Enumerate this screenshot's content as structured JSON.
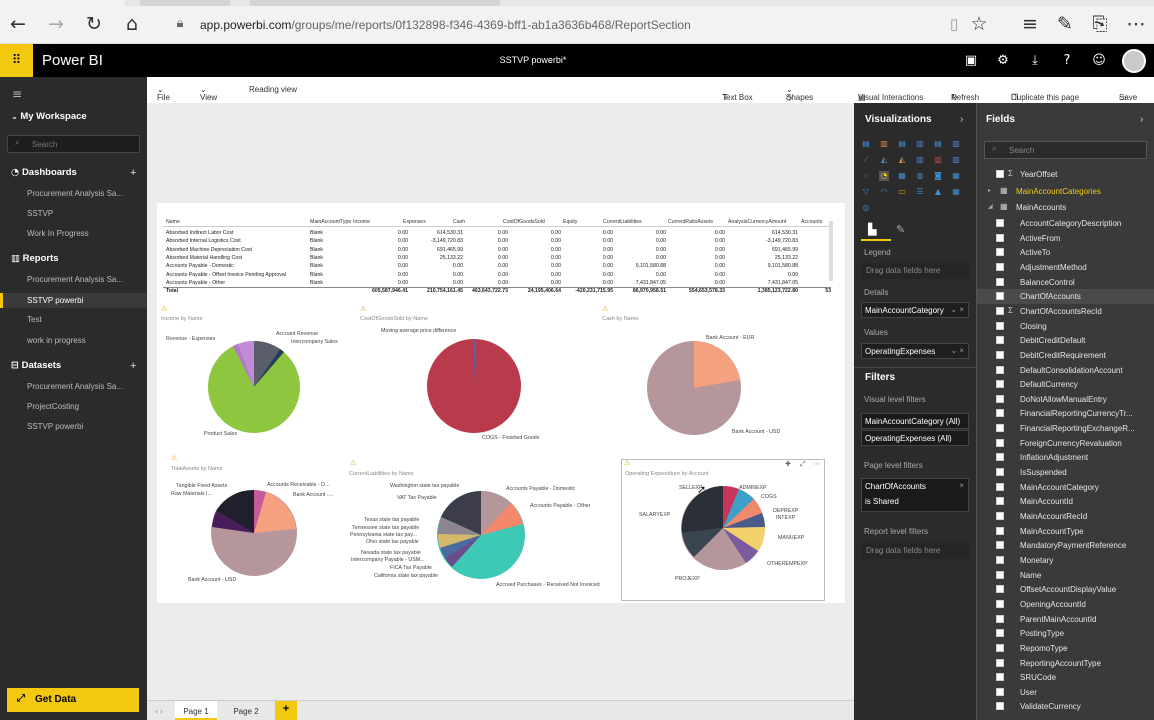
{
  "browser": {
    "url_domain": "app.powerbi.com",
    "url_path": "/groups/me/reports/0f132898-f346-4369-bff1-ab1a3636b468/ReportSection",
    "icons": [
      "back-icon",
      "forward-icon",
      "refresh-icon",
      "home-icon",
      "lock-icon",
      "reading-view-icon",
      "favorite-star-icon",
      "hub-icon",
      "notes-icon",
      "share-icon",
      "more-icon"
    ]
  },
  "header": {
    "brand": "Power BI",
    "title": "SSTVP powerbi*"
  },
  "nav": {
    "workspace": "My Workspace",
    "search_placeholder": "Search",
    "dashboards_label": "Dashboards",
    "dashboards": [
      "Procurement Analysis Sa...",
      "SSTVP",
      "Work In Progress"
    ],
    "reports_label": "Reports",
    "reports": [
      "Procurement Analysis Sa...",
      "SSTVP powerbi",
      "Test",
      "work in progress"
    ],
    "datasets_label": "Datasets",
    "datasets": [
      "Procurement Analysis Sa...",
      "ProjectCosting",
      "SSTVP powerbi"
    ],
    "get_data": "Get Data"
  },
  "toolbar": {
    "file": "File",
    "view": "View",
    "reading_view": "Reading view",
    "text_box": "Text Box",
    "shapes": "Shapes",
    "visual_interactions": "Visual Interactions",
    "refresh": "Refresh",
    "duplicate": "Duplicate this page",
    "save": "Save"
  },
  "table": {
    "headers": [
      "Name",
      "MainAccountType",
      "Income",
      "Expenses",
      "Cash",
      "CostOfGoodsSold",
      "Equity",
      "CurrentLiabilities",
      "CurrentRatioAssets",
      "AnalysisCurrencyAmount",
      "Accounts"
    ],
    "rows": [
      [
        "Absorbed Indirect Labor Cost",
        "Blank",
        "0.00",
        "614,530.31",
        "0.00",
        "0.00",
        "0.00",
        "0.00",
        "0.00",
        "614,530.31"
      ],
      [
        "Absorbed Internal Logistics Cost",
        "Blank",
        "0.00",
        "-3,149,720.83",
        "0.00",
        "0.00",
        "0.00",
        "0.00",
        "0.00",
        "-3,149,720.83"
      ],
      [
        "Absorbed Machine Depreciation Cost",
        "Blank",
        "0.00",
        "691,465.99",
        "0.00",
        "0.00",
        "0.00",
        "0.00",
        "0.00",
        "691,465.99"
      ],
      [
        "Absorbed Material Handling Cost",
        "Blank",
        "0.00",
        "25,133.22",
        "0.00",
        "0.00",
        "0.00",
        "0.00",
        "0.00",
        "25,133.22"
      ],
      [
        "Accounts Payable - Domestic",
        "Blank",
        "0.00",
        "0.00",
        "0.00",
        "0.00",
        "0.00",
        "9,101,580.88",
        "0.00",
        "9,101,580.88"
      ],
      [
        "Accounts Payable - Offset Invoice Pending Approval",
        "Blank",
        "0.00",
        "0.00",
        "0.00",
        "0.00",
        "0.00",
        "0.00",
        "0.00",
        "0.00"
      ],
      [
        "Accounts Payable - Other",
        "Blank",
        "0.00",
        "0.00",
        "0.00",
        "0.00",
        "0.00",
        "7,431,847.05",
        "0.00",
        "7,431,847.05"
      ]
    ],
    "total": [
      "Total",
      "",
      "605,587,946.41",
      "210,754,161.45",
      "463,643,722.73",
      "24,195,406.64",
      "-420,231,715.95",
      "86,970,958.51",
      "554,653,578.33",
      "1,385,123,722.80",
      "53"
    ]
  },
  "charts": [
    {
      "title": "Income by Name",
      "labels": [
        "Revenue - Expenses",
        "Accrued Revenue",
        "Intercompany Sales",
        "Product Sales"
      ]
    },
    {
      "title": "CostOfGoodsSold by Name",
      "labels": [
        "Moving average price difference",
        "COGS - Finished Goods"
      ]
    },
    {
      "title": "Cash by Name",
      "labels": [
        "Bank Account - EUR",
        "Bank Account - USD"
      ]
    },
    {
      "title": "TotalAssets by Name",
      "labels": [
        "Tangible Fixed Assets",
        "Raw Materials I...",
        "Accounts Receivable - D...",
        "Bank Account -...",
        "Bank Account - USD"
      ]
    },
    {
      "title": "CurrentLiabilities by Name",
      "labels": [
        "Washington state tax payable",
        "Accounts Payable - Domestic",
        "VAT Tax Payable",
        "Accounts Payable - Other",
        "Texas state tax payable",
        "Tennessee state tax payable",
        "Pennsylvania state tax pay...",
        "Ohio state tax payable",
        "Nevada state tax payable",
        "Intercompany Payable - USM...",
        "FICA Tax Payable",
        "California state tax payable",
        "Accrued Purchases - Received Not Invoiced"
      ]
    },
    {
      "title": "Operating Expenditure by Account",
      "labels": [
        "SELLEXP",
        "ADMINEXP",
        "COGS",
        "SALARYEXP",
        "DEPREXP",
        "INTEXP",
        "MANUEXP",
        "OTHEREMPEXP",
        "PROJEXP"
      ]
    }
  ],
  "visualizations": {
    "title": "Visualizations",
    "legend_label": "Legend",
    "legend_drop": "Drag data fields here",
    "details_label": "Details",
    "details_value": "MainAccountCategory",
    "values_label": "Values",
    "values_value": "OperatingExpenses"
  },
  "filters": {
    "title": "Filters",
    "visual_level": "Visual level filters",
    "visual_items": [
      "MainAccountCategory (All)",
      "OperatingExpenses (All)"
    ],
    "page_level": "Page level filters",
    "page_item_name": "ChartOfAccounts",
    "page_item_state": "is Shared",
    "report_level": "Report level filters",
    "report_drop": "Drag data fields here"
  },
  "fields": {
    "title": "Fields",
    "search_placeholder": "Search",
    "tables": [
      "YearOffset",
      "MainAccountCategories",
      "MainAccounts"
    ],
    "items": [
      "AccountCategoryDescription",
      "ActiveFrom",
      "ActiveTo",
      "AdjustmentMethod",
      "BalanceControl",
      "ChartOfAccounts",
      "ChartOfAccountsRecId",
      "Closing",
      "DebitCreditDefault",
      "DebitCreditRequirement",
      "DefaultConsolidationAccount",
      "DefaultCurrency",
      "DoNotAllowManualEntry",
      "FinancialReportingCurrencyTr...",
      "FinancialReportingExchangeR...",
      "ForeignCurrencyRevaluation",
      "InflationAdjustment",
      "IsSuspended",
      "MainAccountCategory",
      "MainAccountId",
      "MainAccountRecId",
      "MainAccountType",
      "MandatoryPaymentReference",
      "Monetary",
      "Name",
      "OffsetAccountDisplayValue",
      "OpeningAccountId",
      "ParentMainAccountId",
      "PostingType",
      "RepomoType",
      "ReportingAccountType",
      "SRUCode",
      "User",
      "ValidateCurrency"
    ]
  },
  "pages": [
    "Page 1",
    "Page 2"
  ],
  "add_page": "+"
}
